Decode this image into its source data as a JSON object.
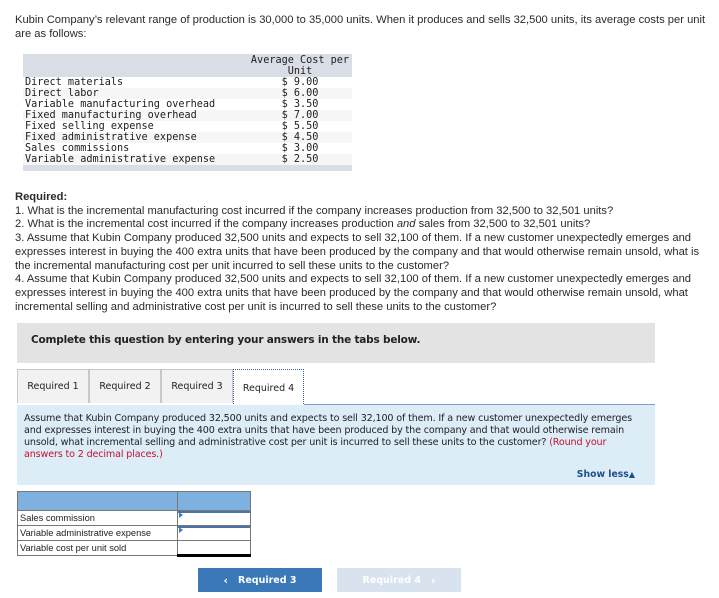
{
  "intro": "Kubin Company’s relevant range of production is 30,000 to 35,000 units. When it produces and sells 32,500 units, its average costs per unit are as follows:",
  "cost_table": {
    "header": "Average Cost per Unit",
    "rows": [
      {
        "label": "Direct materials",
        "value": "$ 9.00"
      },
      {
        "label": "Direct labor",
        "value": "$ 6.00"
      },
      {
        "label": "Variable manufacturing overhead",
        "value": "$ 3.50"
      },
      {
        "label": "Fixed manufacturing overhead",
        "value": "$ 7.00"
      },
      {
        "label": "Fixed selling expense",
        "value": "$ 5.50"
      },
      {
        "label": "Fixed administrative expense",
        "value": "$ 4.50"
      },
      {
        "label": "Sales commissions",
        "value": "$ 3.00"
      },
      {
        "label": "Variable administrative expense",
        "value": "$ 2.50"
      }
    ]
  },
  "required": {
    "heading": "Required:",
    "q1": "1. What is the incremental manufacturing cost incurred if the company increases production from 32,500 to 32,501 units?",
    "q2_pre": "2. What is the incremental cost incurred if the company increases production ",
    "q2_em": "and",
    "q2_post": " sales from 32,500 to 32,501 units?",
    "q3": "3. Assume that Kubin Company produced 32,500 units and expects to sell 32,100 of them. If a new customer unexpectedly emerges and expresses interest in buying the 400 extra units that have been produced by the company and that would otherwise remain unsold, what is the incremental manufacturing cost per unit incurred to sell these units to the customer?",
    "q4": "4. Assume that Kubin Company produced 32,500 units and expects to sell 32,100 of them. If a new customer unexpectedly emerges and expresses interest in buying the 400 extra units that have been produced by the company and that would otherwise remain unsold, what incremental selling and administrative cost per unit is incurred to sell these units to the customer?"
  },
  "instructions": "Complete this question by entering your answers in the tabs below.",
  "tabs": [
    {
      "label": "Required 1",
      "active": false
    },
    {
      "label": "Required 2",
      "active": false
    },
    {
      "label": "Required 3",
      "active": false
    },
    {
      "label": "Required 4",
      "active": true
    }
  ],
  "panel": {
    "question": "Assume that Kubin Company produced 32,500 units and expects to sell 32,100 of them. If a new customer unexpectedly emerges and expresses interest in buying the 400 extra units that have been produced by the company and that would otherwise remain unsold, what incremental selling and administrative cost per unit is incurred to sell these units to the customer? ",
    "round_note": "(Round your answers to 2 decimal places.)",
    "show_less": "Show less",
    "show_less_icon": "▲"
  },
  "answer_table": {
    "rows": [
      {
        "label": "Sales commission",
        "value": ""
      },
      {
        "label": "Variable administrative expense",
        "value": ""
      },
      {
        "label": "Variable cost per unit sold",
        "value": ""
      }
    ]
  },
  "nav": {
    "prev_label": "Required 3",
    "prev_icon": "‹",
    "next_label": "Required 4",
    "next_icon": "›"
  }
}
